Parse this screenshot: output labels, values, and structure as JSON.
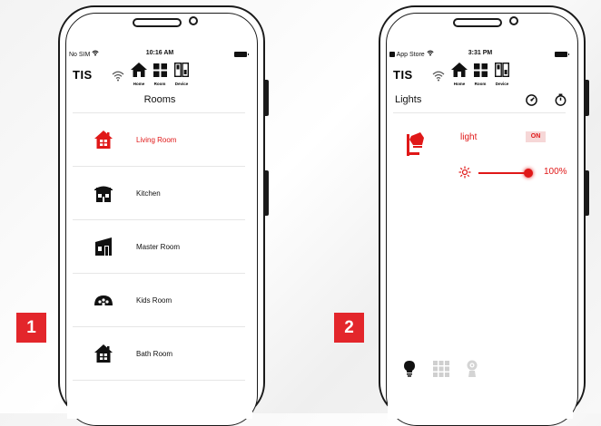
{
  "colors": {
    "accent": "#e01818",
    "badge": "#e3262b",
    "text": "#111111"
  },
  "phone1": {
    "badge": "1",
    "status": {
      "carrier": "No SIM",
      "time": "10:16 AM"
    },
    "logo": "TIS",
    "nav": {
      "home": "Home",
      "room": "Room",
      "device": "Device"
    },
    "title": "Rooms",
    "rooms": [
      {
        "label": "Living Room",
        "icon": "house-icon",
        "active": true
      },
      {
        "label": "Kitchen",
        "icon": "kitchen-icon",
        "active": false
      },
      {
        "label": "Master Room",
        "icon": "master-room-icon",
        "active": false
      },
      {
        "label": "Kids Room",
        "icon": "kids-room-icon",
        "active": false
      },
      {
        "label": "Bath Room",
        "icon": "bath-room-icon",
        "active": false
      }
    ]
  },
  "phone2": {
    "badge": "2",
    "status": {
      "carrier": "App Store",
      "time": "3:31 PM"
    },
    "logo": "TIS",
    "nav": {
      "home": "Home",
      "room": "Room",
      "device": "Device"
    },
    "title": "Lights",
    "device": {
      "name": "light",
      "state": "ON",
      "level_percent": 100,
      "level_text": "100%"
    },
    "bottom_tabs": [
      "bulb-icon",
      "grid-icon",
      "camera-icon"
    ]
  }
}
